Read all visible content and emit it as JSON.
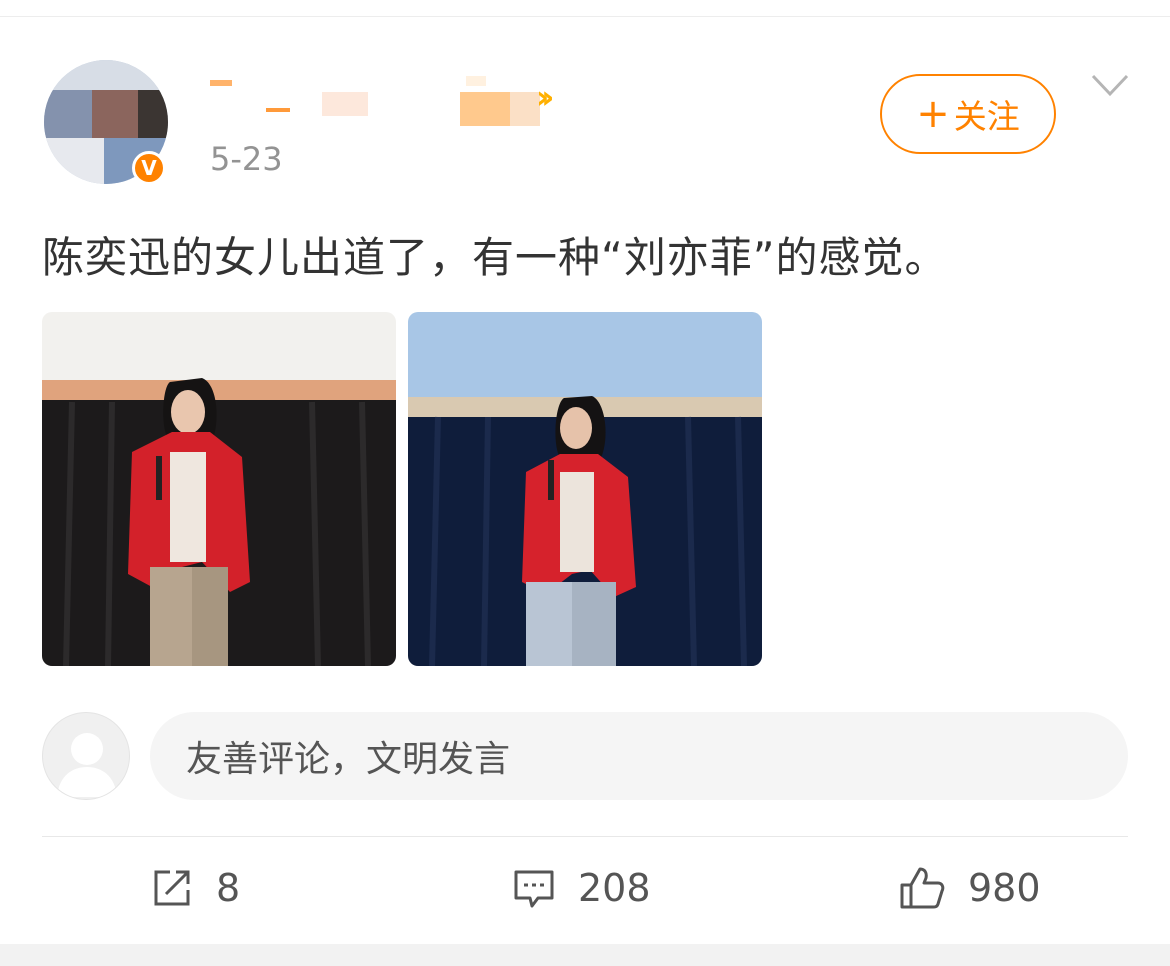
{
  "post": {
    "timestamp": "5-23",
    "text": "陈奕迅的女儿出道了，有一种“刘亦菲”的感觉。",
    "verified_badge": "V",
    "follow_label": "关注",
    "follow_plus": "+"
  },
  "comment": {
    "placeholder": "友善评论，文明发言"
  },
  "actions": {
    "repost_count": "8",
    "comment_count": "208",
    "like_count": "980"
  },
  "colors": {
    "accent": "#ff8200",
    "text": "#333333",
    "muted": "#939393"
  },
  "icons": [
    "verified-badge-icon",
    "chevron-down-icon",
    "repost-icon",
    "comment-icon",
    "like-icon",
    "default-avatar-icon"
  ]
}
